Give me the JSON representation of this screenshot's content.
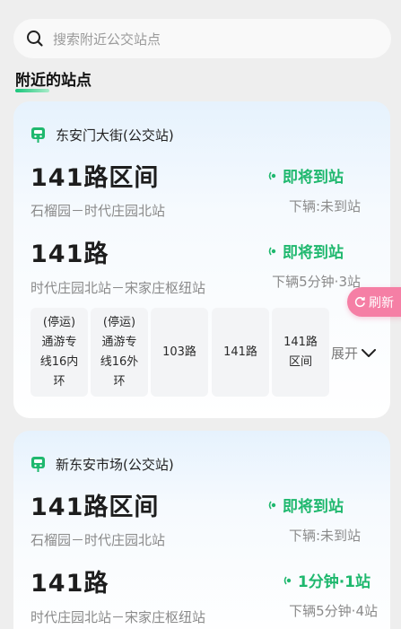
{
  "search": {
    "placeholder": "搜索附近公交站点"
  },
  "section_title": "附近的站点",
  "stations": [
    {
      "name": "东安门大街(公交站)",
      "routes": [
        {
          "name": "141路区间",
          "desc": "石榴园－时代庄园北站",
          "status": "即将到站",
          "next": "下辆:未到站"
        },
        {
          "name": "141路",
          "desc": "时代庄园北站－宋家庄枢纽站",
          "status": "即将到站",
          "next": "下辆5分钟·3站"
        }
      ],
      "chips": [
        "(停运)\n通游专\n线16内\n环",
        "(停运)\n通游专\n线16外\n环",
        "103路",
        "141路",
        "141路\n区间"
      ],
      "expand_label": "展开"
    },
    {
      "name": "新东安市场(公交站)",
      "routes": [
        {
          "name": "141路区间",
          "desc": "石榴园－时代庄园北站",
          "status": "即将到站",
          "next": "下辆:未到站"
        },
        {
          "name": "141路",
          "desc": "时代庄园北站－宋家庄枢纽站",
          "status": "1分钟·1站",
          "next": "下辆5分钟·4站"
        }
      ]
    }
  ],
  "refresh_label": "刷新",
  "colors": {
    "accent_green": "#1fb86e",
    "refresh_pink": "#f57fa5",
    "card_top": "#e6f2fd"
  },
  "icons": {
    "search": "search-icon",
    "stop": "bus-stop-icon",
    "signal": "realtime-signal-icon",
    "expand": "chevron-down-icon",
    "refresh": "refresh-icon"
  }
}
